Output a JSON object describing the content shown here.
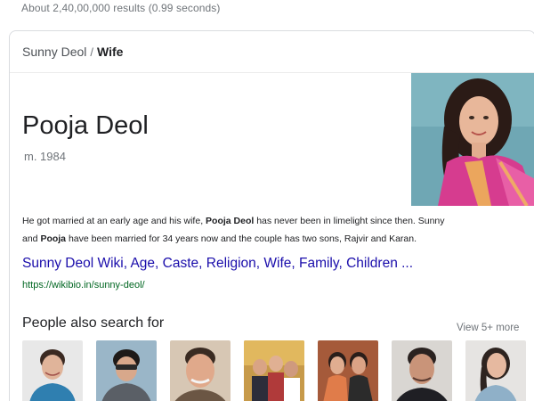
{
  "search": {
    "results_count": "About 2,40,00,000 results (0.99 seconds)"
  },
  "knowledge_panel": {
    "breadcrumb": {
      "parent": "Sunny Deol",
      "separator": "/",
      "current": "Wife"
    },
    "title": "Pooja Deol",
    "subtitle": "m. 1984",
    "portrait_icon": "person-photo",
    "description": {
      "line1_prefix": "He got married at an early age and his wife, ",
      "line1_bold": "Pooja Deol",
      "line1_suffix": " has never been in limelight since then. Sunny",
      "line2_prefix": "and ",
      "line2_bold": "Pooja",
      "line2_suffix": " have been married for 34 years now and the couple has two sons, Rajvir and Karan."
    },
    "source_link": {
      "title": "Sunny Deol Wiki, Age, Caste, Religion, Wife, Family, Children ...",
      "url": "https://wikibio.in/sunny-deol/"
    },
    "people_also_search": {
      "heading": "People also search for",
      "view_more": "View 5+ more",
      "thumbnails": [
        {
          "icon": "person-photo"
        },
        {
          "icon": "person-photo"
        },
        {
          "icon": "person-photo"
        },
        {
          "icon": "group-photo"
        },
        {
          "icon": "group-photo"
        },
        {
          "icon": "person-photo"
        },
        {
          "icon": "person-photo"
        }
      ]
    }
  },
  "colors": {
    "link": "#1a0dab",
    "url": "#006621",
    "muted": "#70757a",
    "border": "#dadce0"
  }
}
